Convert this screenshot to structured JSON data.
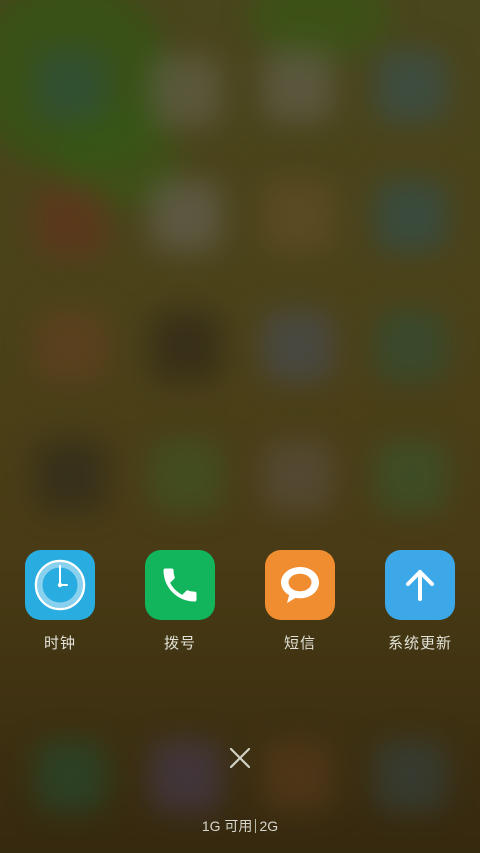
{
  "recent_apps": [
    {
      "label": "时钟",
      "icon": "clock-icon",
      "color": "#29ace0"
    },
    {
      "label": "拨号",
      "icon": "phone-icon",
      "color": "#12b55c"
    },
    {
      "label": "短信",
      "icon": "message-icon",
      "color": "#f08d31"
    },
    {
      "label": "系统更新",
      "icon": "arrow-up-icon",
      "color": "#3ca8e8"
    }
  ],
  "close_icon": "close-icon",
  "memory": {
    "available": "1G 可用",
    "total": "2G"
  }
}
